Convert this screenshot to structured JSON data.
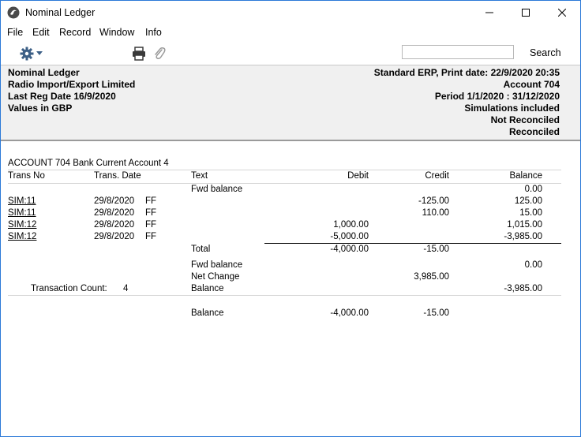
{
  "window": {
    "title": "Nominal Ledger"
  },
  "menu": [
    "File",
    "Edit",
    "Record",
    "Window",
    "Info"
  ],
  "toolbar": {
    "search_value": "",
    "search_label": "Search"
  },
  "header": {
    "left": [
      "Nominal Ledger",
      "Radio Import/Export Limited",
      "Last Reg Date  16/9/2020",
      "Values in GBP"
    ],
    "right": [
      "Standard ERP, Print date: 22/9/2020 20:35",
      "Account  704",
      "Period  1/1/2020 : 31/12/2020",
      "Simulations included",
      "Not Reconciled",
      "Reconciled"
    ]
  },
  "report": {
    "account_title": "ACCOUNT 704  Bank Current Account 4",
    "columns": {
      "trans_no": "Trans No",
      "date": "Trans. Date",
      "text": "Text",
      "debit": "Debit",
      "credit": "Credit",
      "balance": "Balance"
    },
    "fwd_row": {
      "text": "Fwd balance",
      "balance": "0.00"
    },
    "rows": [
      {
        "trans_no": "SIM:11",
        "date": "29/8/2020",
        "code": "FF",
        "debit": "",
        "credit": "-125.00",
        "balance": "125.00"
      },
      {
        "trans_no": "SIM:11",
        "date": "29/8/2020",
        "code": "FF",
        "debit": "",
        "credit": "110.00",
        "balance": "15.00"
      },
      {
        "trans_no": "SIM:12",
        "date": "29/8/2020",
        "code": "FF",
        "debit": "1,000.00",
        "credit": "",
        "balance": "1,015.00"
      },
      {
        "trans_no": "SIM:12",
        "date": "29/8/2020",
        "code": "FF",
        "debit": "-5,000.00",
        "credit": "",
        "balance": "-3,985.00"
      }
    ],
    "total": {
      "label": "Total",
      "debit": "-4,000.00",
      "credit": "-15.00"
    },
    "summary": {
      "fwd_label": "Fwd balance",
      "fwd_balance": "0.00",
      "net_change_label": "Net Change",
      "net_change_credit": "3,985.00",
      "trans_count_label": "Transaction Count:",
      "trans_count": "4",
      "balance_label": "Balance",
      "balance": "-3,985.00"
    },
    "grand": {
      "label": "Balance",
      "debit": "-4,000.00",
      "credit": "-15.00"
    }
  }
}
